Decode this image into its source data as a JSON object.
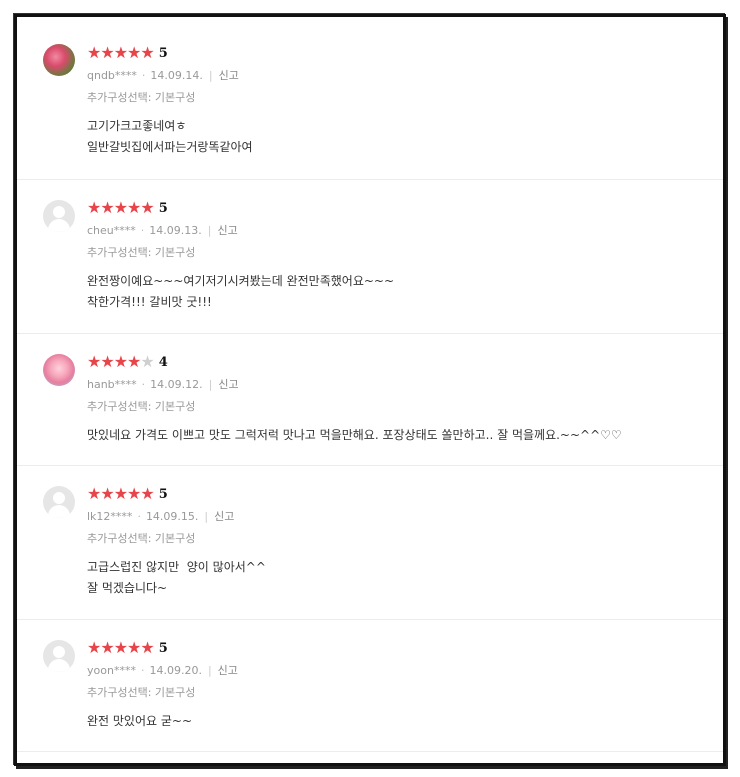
{
  "colors": {
    "star_on": "#e8454a",
    "star_off": "#cfcfcf",
    "meta": "#999999",
    "text": "#333333"
  },
  "reviews": [
    {
      "avatar": "photo-avatar",
      "rating": 5,
      "stars_filled": 5,
      "score": "5",
      "user": "qndb****",
      "date": "14.09.14.",
      "report": "신고",
      "option": "추가구성선택: 기본구성",
      "lines": [
        "고기가크고좋네여ㅎ",
        "일반갈빗집에서파는거랑똑같아여"
      ]
    },
    {
      "avatar": "default-avatar",
      "rating": 5,
      "stars_filled": 5,
      "score": "5",
      "user": "cheu****",
      "date": "14.09.13.",
      "report": "신고",
      "option": "추가구성선택: 기본구성",
      "lines": [
        "완전짱이예요~~~여기저기시켜봤는데 완전만족했어요~~~",
        "착한가격!!! 갈비맛 굿!!!"
      ]
    },
    {
      "avatar": "photo-avatar",
      "rating": 4,
      "stars_filled": 4,
      "score": "4",
      "user": "hanb****",
      "date": "14.09.12.",
      "report": "신고",
      "option": "추가구성선택: 기본구성",
      "lines": [
        "맛있네요 가격도 이쁘고 맛도 그럭저럭 맛나고 먹을만해요. 포장상태도 쏠만하고.. 잘 먹을께요.~~^^♡♡"
      ]
    },
    {
      "avatar": "default-avatar",
      "rating": 5,
      "stars_filled": 5,
      "score": "5",
      "user": "lk12****",
      "date": "14.09.15.",
      "report": "신고",
      "option": "추가구성선택: 기본구성",
      "lines": [
        "고급스럽진 않지만  양이 많아서^^",
        "잘 먹겠습니다~"
      ]
    },
    {
      "avatar": "default-avatar",
      "rating": 5,
      "stars_filled": 5,
      "score": "5",
      "user": "yoon****",
      "date": "14.09.20.",
      "report": "신고",
      "option": "추가구성선택: 기본구성",
      "lines": [
        "완전 맛있어요 굳~~"
      ]
    }
  ]
}
